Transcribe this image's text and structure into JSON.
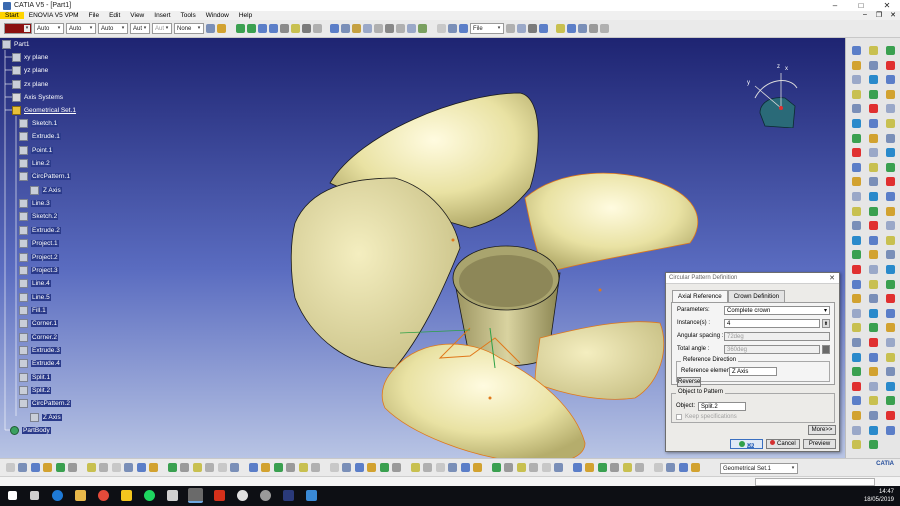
{
  "window": {
    "title": "CATIA V5 - [Part1]",
    "minimize": "–",
    "maximize": "□",
    "close": "✕"
  },
  "menu": {
    "items": [
      "Start",
      "ENOVIA V5 VPM",
      "File",
      "Edit",
      "View",
      "Insert",
      "Tools",
      "Window",
      "Help"
    ],
    "doc_controls": [
      "–",
      "❐",
      "✕"
    ]
  },
  "toolbar": {
    "color_combo": "",
    "combo_auto_1": "Auto",
    "combo_auto_2": "Auto",
    "combo_auto_3": "Auto",
    "combo_auto_4": "Aut",
    "combo_auto_5": "Aut",
    "combo_none": "None",
    "combo_file": "File"
  },
  "tree": {
    "root": "Part1",
    "planes": [
      "xy plane",
      "yz plane",
      "zx plane"
    ],
    "axis_systems": "Axis Systems",
    "geoset": "Geometrical Set.1",
    "features": [
      "Sketch.1",
      "Extrude.1",
      "Point.1",
      "Line.2",
      "CircPattern.1",
      "Z Axis",
      "Line.3",
      "Sketch.2",
      "Extrude.2",
      "Project.1",
      "Project.2",
      "Project.3",
      "Line.4",
      "Line.5",
      "Fill.1",
      "Corner.1",
      "Corner.2",
      "Extrude.3",
      "Extrude.4",
      "Split.1",
      "Split.2",
      "CircPattern.2",
      "Z Axis"
    ],
    "partbody": "PartBody"
  },
  "compass": {
    "x": "x",
    "y": "y",
    "z": "z"
  },
  "dialog": {
    "title": "Circular Pattern Definition",
    "tabs": [
      "Axial Reference",
      "Crown Definition"
    ],
    "parameters_label": "Parameters:",
    "parameters_value": "Complete crown",
    "instances_label": "Instance(s) :",
    "instances_value": "4",
    "angular_spacing_label": "Angular spacing :",
    "angular_spacing_value": "72deg",
    "total_angle_label": "Total angle :",
    "total_angle_value": "360deg",
    "reference_direction_label": "Reference Direction",
    "reference_element_label": "Reference element:",
    "reference_element_value": "Z Axis",
    "reverse_button": "Reverse",
    "object_to_pattern_label": "Object to Pattern",
    "object_label": "Object:",
    "object_value": "Split.2",
    "keep_specifications": "Keep specifications",
    "more_button": "More>>",
    "ok_button": "OK",
    "cancel_button": "Cancel",
    "preview_button": "Preview"
  },
  "bottombar": {
    "geoset_combo": "Geometrical Set.1",
    "logo": "CATIA"
  },
  "taskbar": {
    "time": "14:47",
    "date": "18/05/2019"
  },
  "colors": {
    "viewport_top": "#1e2472",
    "viewport_bottom": "#b8c4e4",
    "surface": "#efe9a8",
    "edge": "#e0781a",
    "start_menu": "#ffd400"
  }
}
